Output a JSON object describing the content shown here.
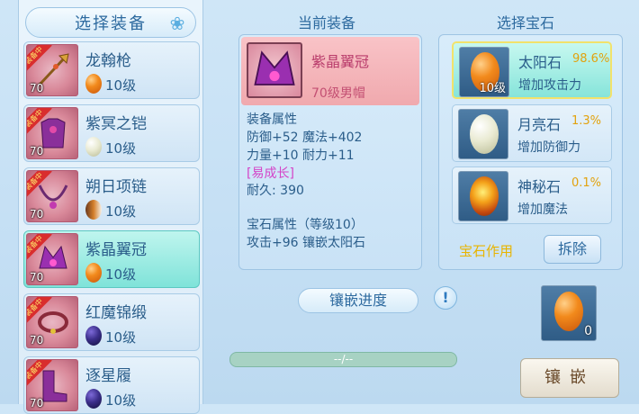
{
  "left": {
    "header": "选择装备",
    "items": [
      {
        "name": "龙翰枪",
        "level": "70",
        "gem_level": "10级",
        "gem_type": "orange",
        "equipped": true,
        "ribbon": "装备中"
      },
      {
        "name": "紫冥之铠",
        "level": "70",
        "gem_level": "10级",
        "gem_type": "pearl",
        "equipped": true,
        "ribbon": "装备中"
      },
      {
        "name": "朔日项链",
        "level": "70",
        "gem_level": "10级",
        "gem_type": "mixed",
        "equipped": true,
        "ribbon": "装备中"
      },
      {
        "name": "紫晶翼冠",
        "level": "70",
        "gem_level": "10级",
        "gem_type": "orange",
        "equipped": true,
        "ribbon": "装备中",
        "selected": true
      },
      {
        "name": "红魔锦缎",
        "level": "70",
        "gem_level": "10级",
        "gem_type": "dark",
        "equipped": true,
        "ribbon": "装备中"
      },
      {
        "name": "逐星履",
        "level": "70",
        "gem_level": "10级",
        "gem_type": "dark",
        "equipped": true,
        "ribbon": "装备中"
      }
    ]
  },
  "current": {
    "title": "当前装备",
    "name": "紫晶翼冠",
    "subtitle": "70级男帽",
    "attr_title": "装备属性",
    "attr_line1": "防御+52 魔法+402",
    "attr_line2": "力量+10 耐力+11",
    "growth": "[易成长]",
    "durability": "耐久: 390",
    "gem_attr_title": "宝石属性（等级10）",
    "gem_attr_line": "攻击+96 镶嵌太阳石"
  },
  "gems": {
    "title": "选择宝石",
    "rows": [
      {
        "name": "太阳石",
        "percent": "98.6%",
        "desc": "增加攻击力",
        "level": "10级",
        "type": "orange",
        "selected": true
      },
      {
        "name": "月亮石",
        "percent": "1.3%",
        "desc": "增加防御力",
        "level": "",
        "type": "pearl"
      },
      {
        "name": "神秘石",
        "percent": "0.1%",
        "desc": "增加魔法",
        "level": "",
        "type": "fire"
      }
    ],
    "effect_label": "宝石作用",
    "remove_button": "拆除"
  },
  "inlay": {
    "progress_label": "镶嵌进度",
    "info_icon": "!",
    "progress_text": "--/--",
    "progress_value": 0.0,
    "slot_count": "0",
    "button": "镶嵌"
  }
}
